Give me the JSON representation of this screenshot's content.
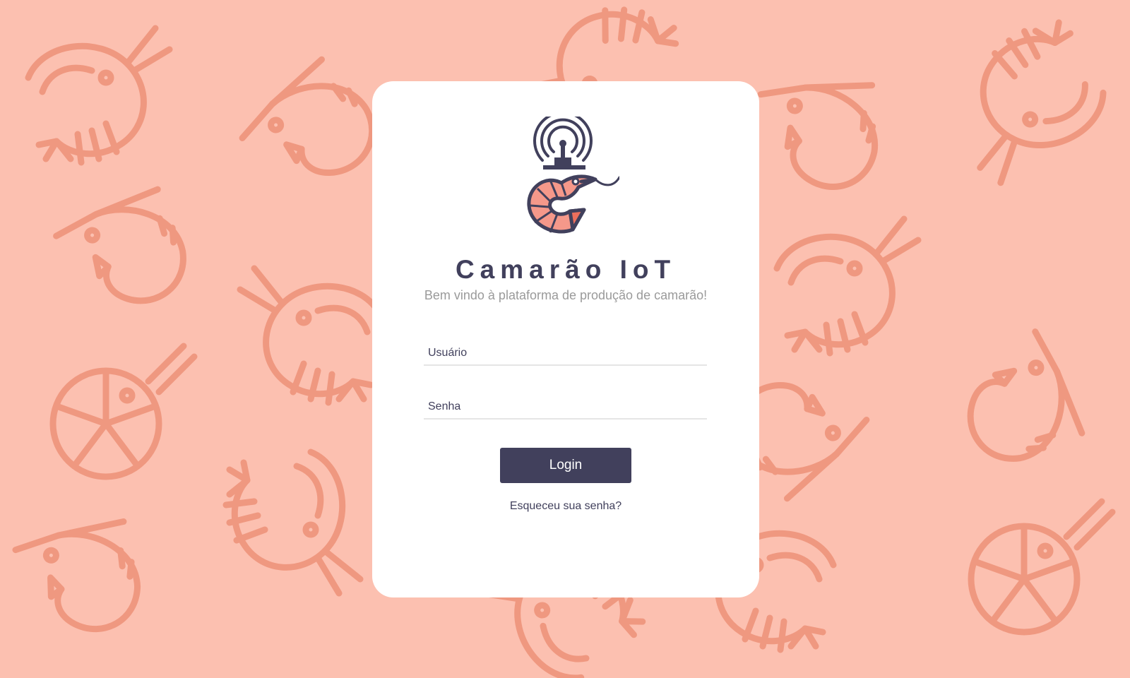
{
  "app": {
    "title": "Camarão IoT",
    "subtitle": "Bem vindo à plataforma de produção de camarão!"
  },
  "form": {
    "username_placeholder": "Usuário",
    "username_value": "",
    "password_placeholder": "Senha",
    "password_value": "",
    "login_label": "Login",
    "forgot_label": "Esqueceu sua senha?"
  },
  "icons": {
    "logo": "shrimp-antenna-logo-icon",
    "background": "shrimp-pattern-icon"
  },
  "colors": {
    "background": "#fcc0b0",
    "pattern": "#ef9880",
    "card": "#ffffff",
    "primary": "#41405c",
    "subtitle": "#9a9a9a",
    "shrimp_body": "#f5988a",
    "shrimp_accent": "#ec6f5c"
  }
}
